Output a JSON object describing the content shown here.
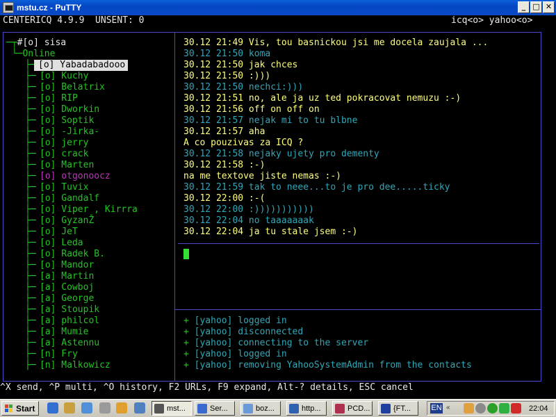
{
  "window": {
    "title": "mstu.cz - PuTTY",
    "min_glyph": "_",
    "max_glyph": "□",
    "close_glyph": "✕"
  },
  "status_bar": {
    "left": "CENTERICQ 4.9.9  UNSENT: 0",
    "right": "icq<o> yahoo<o>"
  },
  "contact_tree": {
    "root_prefix": "─┬",
    "root": "#[o] sisa",
    "group_prefix": " └─",
    "group": "Online",
    "selected": "[o] Yabadabadooo",
    "branch": "├─",
    "contacts": [
      {
        "label": "[o] Kuchy",
        "color": "green"
      },
      {
        "label": "[o] Belatrix",
        "color": "green"
      },
      {
        "label": "[o] RIP",
        "color": "green"
      },
      {
        "label": "[o] Dworkin",
        "color": "green"
      },
      {
        "label": "[o] Soptik",
        "color": "green"
      },
      {
        "label": "[o] -Jirka-",
        "color": "green"
      },
      {
        "label": "[o] jerry",
        "color": "green"
      },
      {
        "label": "[o] crack",
        "color": "green"
      },
      {
        "label": "[o] Marten",
        "color": "green"
      },
      {
        "label": "[o] otgonoocz",
        "color": "magenta"
      },
      {
        "label": "[o] Tuvix",
        "color": "green"
      },
      {
        "label": "[o] Gandalf",
        "color": "green"
      },
      {
        "label": "[o] Viper , Kirrra",
        "color": "green"
      },
      {
        "label": "[o] GyzanŽ",
        "color": "green"
      },
      {
        "label": "[o] JeT",
        "color": "green"
      },
      {
        "label": "[o] Leda",
        "color": "green"
      },
      {
        "label": "[o] Radek B.",
        "color": "green"
      },
      {
        "label": "[o] Mandor",
        "color": "green"
      },
      {
        "label": "[a] Martin",
        "color": "green"
      },
      {
        "label": "[a] Cowboj",
        "color": "green"
      },
      {
        "label": "[a] George",
        "color": "green"
      },
      {
        "label": "[a] Stoupik",
        "color": "green"
      },
      {
        "label": "[a] philcol",
        "color": "green"
      },
      {
        "label": "[a] Mumie",
        "color": "green"
      },
      {
        "label": "[a] Astennu",
        "color": "green"
      },
      {
        "label": "[n] Fry",
        "color": "green"
      },
      {
        "label": "[n] Malkowicz",
        "color": "green"
      }
    ]
  },
  "chat": [
    {
      "text": "30.12 21:49 Vis, tou basnickou jsi me docela zaujala ...",
      "color": "yellow"
    },
    {
      "text": "30.12 21:50 koma",
      "color": "cyan"
    },
    {
      "text": "30.12 21:50 jak chces",
      "color": "yellow"
    },
    {
      "text": "30.12 21:50 :)))",
      "color": "yellow"
    },
    {
      "text": "30.12 21:50 nechci:)))",
      "color": "cyan"
    },
    {
      "text": "30.12 21:51 no, ale ja uz ted pokracovat nemuzu :-)",
      "color": "yellow"
    },
    {
      "text": "30.12 21:56 off on off on",
      "color": "yellow"
    },
    {
      "text": "30.12 21:57 nejak mi to tu blbne",
      "color": "cyan"
    },
    {
      "text": "30.12 21:57 aha",
      "color": "yellow"
    },
    {
      "text": "A co pouzivas za ICQ ?",
      "color": "yellow"
    },
    {
      "text": "30.12 21:58 nejaky ujety pro dementy",
      "color": "cyan"
    },
    {
      "text": "30.12 21:58 :-)",
      "color": "yellow"
    },
    {
      "text": "na me textove jiste nemas :-)",
      "color": "yellow"
    },
    {
      "text": "30.12 21:59 tak to neee...to je pro dee.....ticky",
      "color": "cyan"
    },
    {
      "text": "30.12 22:00 :-(",
      "color": "yellow"
    },
    {
      "text": "30.12 22:00 :)))))))))))",
      "color": "cyan"
    },
    {
      "text": "30.12 22:04 no taaaaaaak",
      "color": "cyan"
    },
    {
      "text": "30.12 22:04 ja tu stale jsem :-)",
      "color": "yellow"
    }
  ],
  "log": [
    {
      "plus": "+",
      "tag": "[yahoo]",
      "msg": "logged in"
    },
    {
      "plus": "+",
      "tag": "[yahoo]",
      "msg": "disconnected"
    },
    {
      "plus": "+",
      "tag": "[yahoo]",
      "msg": "connecting to the server"
    },
    {
      "plus": "+",
      "tag": "[yahoo]",
      "msg": "logged in"
    },
    {
      "plus": "+",
      "tag": "[yahoo]",
      "msg": "removing YahooSystemAdmin from the contacts"
    }
  ],
  "hint_bar": "^X send, ^P multi, ^O history, F2 URLs, F9 expand, Alt-? details, ESC cancel",
  "taskbar": {
    "start": "Start",
    "tasks": [
      "mst...",
      "Ser...",
      "boz...",
      "http...",
      "PCD...",
      "{FT..."
    ],
    "lang": "EN",
    "clock": "22:04"
  },
  "colors": {
    "border": "#4a4ad0",
    "contact_green": "#1fc81f",
    "incoming": "#2fa8b8",
    "outgoing": "#ffff7a",
    "cursor": "#34e034",
    "title_blue": "#0447c4"
  }
}
